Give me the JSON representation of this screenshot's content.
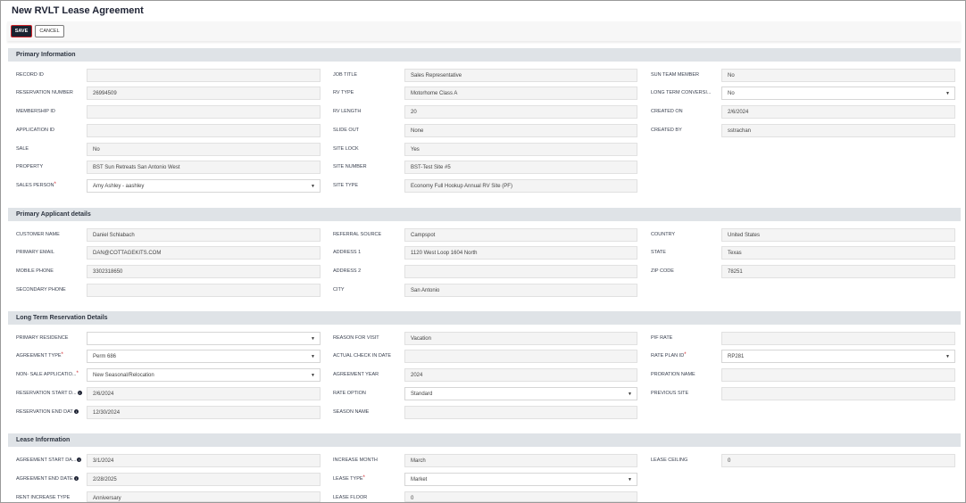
{
  "page": {
    "title": "New RVLT Lease Agreement"
  },
  "toolbar": {
    "save_label": "SAVE",
    "cancel_label": "CANCEL"
  },
  "icons": {
    "dropdown": "chevron-down-icon",
    "info": "info-icon"
  },
  "colors": {
    "save_bg": "#1a2230",
    "save_border": "#d0232a",
    "section_bg": "#dfe3e7",
    "required": "#d0232a"
  },
  "sections": {
    "primary": "Primary Information",
    "applicant": "Primary Applicant details",
    "reservation": "Long Term Reservation Details",
    "lease": "Lease Information"
  },
  "primary": {
    "record_id": {
      "label": "RECORD ID",
      "value": ""
    },
    "reservation_number": {
      "label": "RESERVATION NUMBER",
      "value": "26994509"
    },
    "membership_id": {
      "label": "MEMBERSHIP ID",
      "value": ""
    },
    "application_id": {
      "label": "APPLICATION ID",
      "value": ""
    },
    "sale": {
      "label": "SALE",
      "value": "No"
    },
    "property": {
      "label": "PROPERTY",
      "value": "BST Sun Retreats San Antonio West"
    },
    "sales_person": {
      "label": "SALES PERSON",
      "value": "Amy Ashley - aashley"
    },
    "job_title": {
      "label": "JOB TITLE",
      "value": "Sales Representative"
    },
    "rv_type": {
      "label": "RV TYPE",
      "value": "Motorhome Class A"
    },
    "rv_length": {
      "label": "RV LENGTH",
      "value": "20"
    },
    "slide_out": {
      "label": "SLIDE OUT",
      "value": "None"
    },
    "site_lock": {
      "label": "SITE LOCK",
      "value": "Yes"
    },
    "site_number": {
      "label": "SITE NUMBER",
      "value": "BST-Test Site #5"
    },
    "site_type": {
      "label": "SITE TYPE",
      "value": "Economy Full Hookup Annual RV Site (PF)"
    },
    "sun_team_member": {
      "label": "SUN TEAM MEMBER",
      "value": "No"
    },
    "long_term_conversion": {
      "label": "LONG TERM CONVERSI...",
      "value": "No"
    },
    "created_on": {
      "label": "CREATED ON",
      "value": "2/6/2024"
    },
    "created_by": {
      "label": "CREATED BY",
      "value": "sstrachan"
    }
  },
  "applicant": {
    "customer_name": {
      "label": "CUSTOMER NAME",
      "value": "Daniel Schlabach"
    },
    "primary_email": {
      "label": "PRIMARY EMAIL",
      "value": "DAN@COTTAGEKITS.COM"
    },
    "mobile_phone": {
      "label": "MOBILE PHONE",
      "value": "3302318650"
    },
    "secondary_phone": {
      "label": "SECONDARY PHONE",
      "value": ""
    },
    "referral_source": {
      "label": "REFERRAL SOURCE",
      "value": "Campspot"
    },
    "address1": {
      "label": "ADDRESS 1",
      "value": "1120 West Loop 1604 North"
    },
    "address2": {
      "label": "ADDRESS 2",
      "value": ""
    },
    "city": {
      "label": "CITY",
      "value": "San Antonio"
    },
    "country": {
      "label": "COUNTRY",
      "value": "United States"
    },
    "state": {
      "label": "STATE",
      "value": "Texas"
    },
    "zip_code": {
      "label": "ZIP CODE",
      "value": "78251"
    }
  },
  "reservation": {
    "primary_residence": {
      "label": "PRIMARY RESIDENCE",
      "value": ""
    },
    "agreement_type": {
      "label": "AGREEMENT TYPE",
      "value": "Perm 686"
    },
    "non_sale_application": {
      "label": "NON- SALE APPLICATIO...",
      "value": "New Seasonal/Relocation"
    },
    "reservation_start_date": {
      "label": "RESERVATION START D...",
      "value": "2/6/2024"
    },
    "reservation_end_date": {
      "label": "RESERVATION END DAT",
      "value": "12/30/2024"
    },
    "reason_for_visit": {
      "label": "REASON FOR VISIT",
      "value": "Vacation"
    },
    "actual_check_in_date": {
      "label": "ACTUAL CHECK IN DATE",
      "value": ""
    },
    "agreement_year": {
      "label": "AGREEMENT YEAR",
      "value": "2024"
    },
    "rate_option": {
      "label": "RATE OPTION",
      "value": "Standard"
    },
    "season_name": {
      "label": "SEASON NAME",
      "value": ""
    },
    "pif_rate": {
      "label": "PIF RATE",
      "value": ""
    },
    "rate_plan_id": {
      "label": "RATE PLAN ID",
      "value": "RP281"
    },
    "proration_name": {
      "label": "PRORATION NAME",
      "value": ""
    },
    "previous_site": {
      "label": "PREVIOUS SITE",
      "value": ""
    }
  },
  "lease": {
    "agreement_start_date": {
      "label": "AGREEMENT START DA...",
      "value": "3/1/2024"
    },
    "agreement_end_date": {
      "label": "AGREEMENT END DATE",
      "value": "2/28/2025"
    },
    "rent_increase_type": {
      "label": "RENT INCREASE TYPE",
      "value": "Anniversary"
    },
    "increase_month": {
      "label": "INCREASE MONTH",
      "value": "March"
    },
    "lease_type": {
      "label": "LEASE TYPE",
      "value": "Market"
    },
    "lease_floor": {
      "label": "LEASE FLOOR",
      "value": "0"
    },
    "lease_ceiling": {
      "label": "LEASE CEILING",
      "value": "0"
    }
  }
}
